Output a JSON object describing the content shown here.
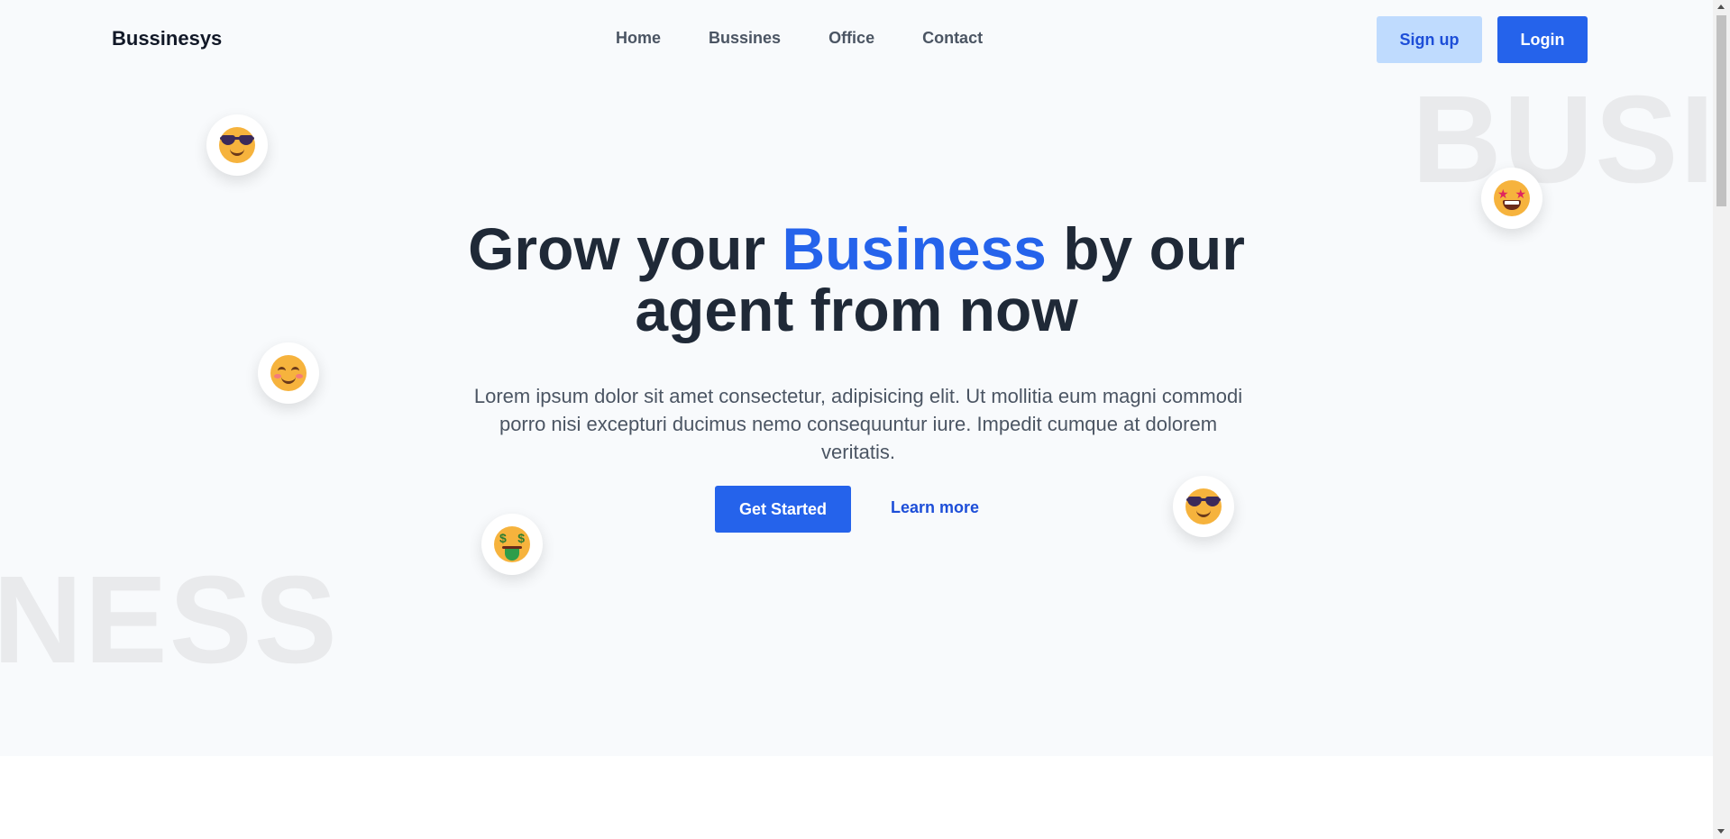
{
  "header": {
    "brand": "Bussinesys",
    "nav": [
      {
        "label": "Home"
      },
      {
        "label": "Bussines"
      },
      {
        "label": "Office"
      },
      {
        "label": "Contact"
      }
    ],
    "signup_label": "Sign up",
    "login_label": "Login"
  },
  "hero": {
    "bg_word_top": "BUSI",
    "bg_word_bottom": "NESS",
    "headline_part1": "Grow your ",
    "headline_accent": "Business",
    "headline_part2": " by our agent from now",
    "subtext": "Lorem ipsum dolor sit amet consectetur, adipisicing elit. Ut mollitia eum magni commodi porro nisi excepturi ducimus nemo consequuntur iure. Impedit cumque at dolorem veritatis.",
    "primary_cta": "Get Started",
    "secondary_cta": "Learn more"
  },
  "emojis": [
    {
      "name": "smiling-face-with-sunglasses"
    },
    {
      "name": "smiling-face-with-smiling-eyes"
    },
    {
      "name": "star-struck"
    },
    {
      "name": "money-mouth-face"
    },
    {
      "name": "smiling-face-with-sunglasses"
    }
  ],
  "colors": {
    "accent": "#2563eb",
    "accent_light": "#bfdbfe",
    "heading": "#1f2937",
    "hero_bg": "#f8fafc"
  }
}
